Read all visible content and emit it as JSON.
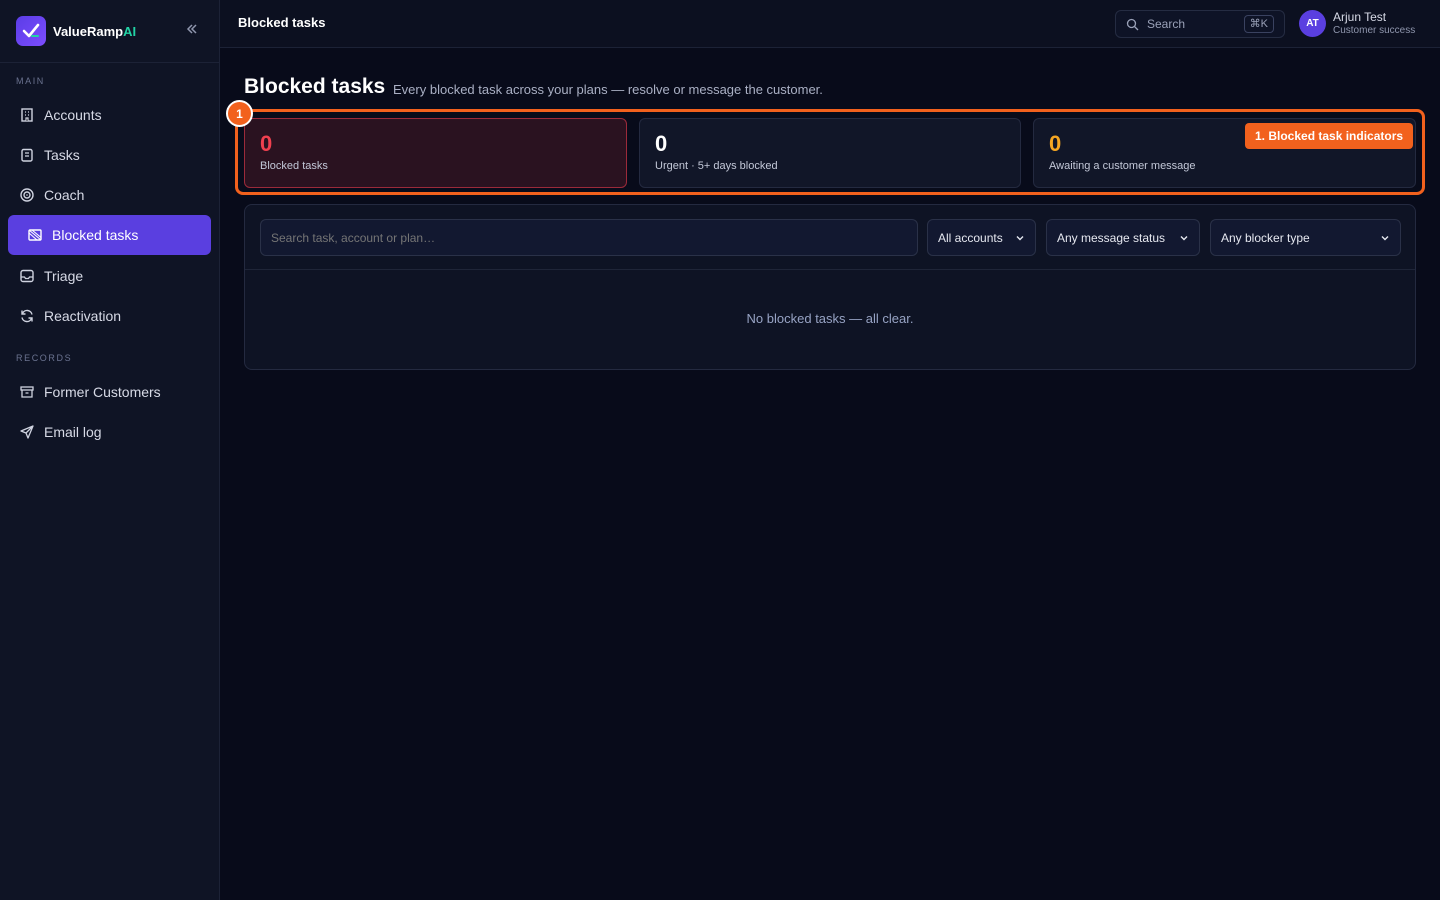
{
  "brand": {
    "name": "ValueRamp",
    "suffix": "AI"
  },
  "sidebar": {
    "sections": [
      "MAIN",
      "RECORDS"
    ],
    "items": [
      {
        "label": "Accounts",
        "icon": "building-icon"
      },
      {
        "label": "Tasks",
        "icon": "clipboard-icon"
      },
      {
        "label": "Coach",
        "icon": "target-icon"
      },
      {
        "label": "Blocked tasks",
        "icon": "blocked-icon",
        "active": true
      },
      {
        "label": "Triage",
        "icon": "inbox-icon"
      },
      {
        "label": "Reactivation",
        "icon": "refresh-icon"
      },
      {
        "label": "Former Customers",
        "icon": "archive-icon"
      },
      {
        "label": "Email log",
        "icon": "send-icon"
      }
    ]
  },
  "topbar": {
    "title": "Blocked tasks",
    "search_label": "Search",
    "shortcut": "⌘K",
    "user": {
      "initials": "AT",
      "name": "Arjun Test",
      "role": "Customer success"
    }
  },
  "page": {
    "title": "Blocked tasks",
    "subtitle": "Every blocked task across your plans — resolve or message the customer."
  },
  "annotation": {
    "number": "1",
    "label": "1. Blocked task indicators"
  },
  "stats": [
    {
      "value": "0",
      "label": "Blocked tasks",
      "color": "#f0404f"
    },
    {
      "value": "0",
      "label": "Urgent · 5+ days blocked",
      "color": "#ffffff"
    },
    {
      "value": "0",
      "label": "Awaiting a customer message",
      "color": "#f5a623"
    }
  ],
  "filters": {
    "search_placeholder": "Search task, account or plan…",
    "accounts": "All accounts",
    "message_status": "Any message status",
    "blocker_type": "Any blocker type"
  },
  "empty_state": "No blocked tasks — all clear.",
  "colors": {
    "accent": "#5a3fe0",
    "highlight": "#f2611d",
    "background": "#080b1a"
  }
}
